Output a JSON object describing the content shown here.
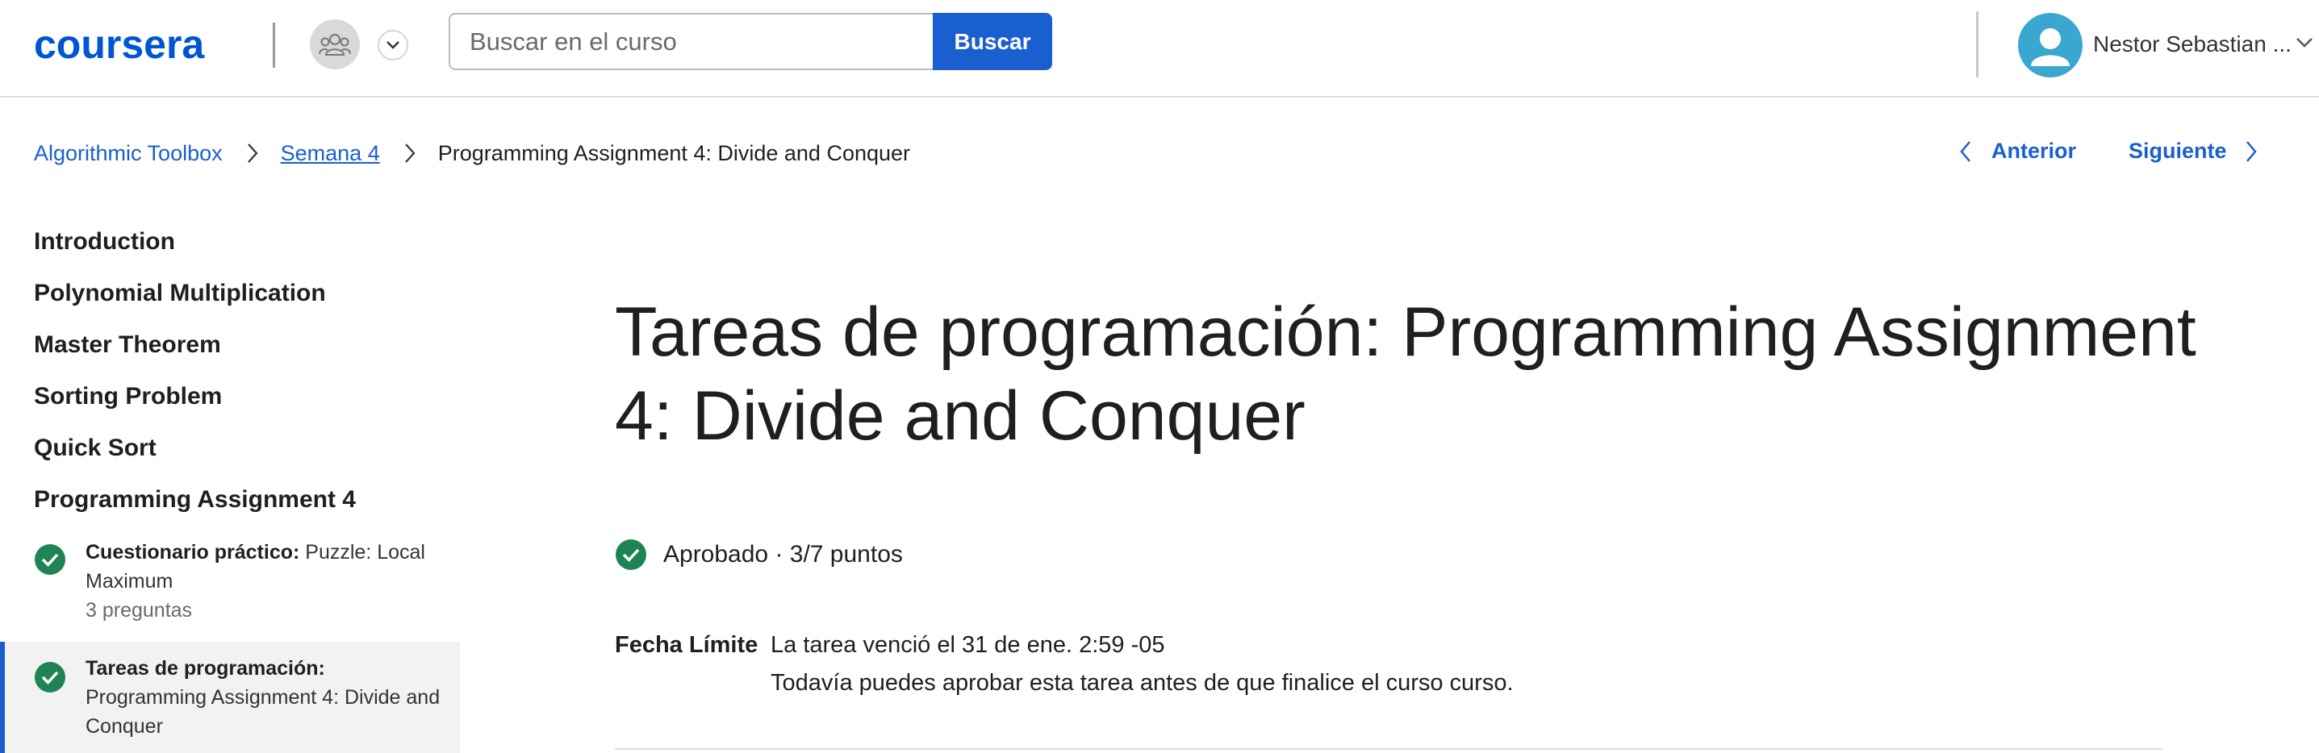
{
  "header": {
    "logo_text": "coursera",
    "search_placeholder": "Buscar en el curso",
    "search_button": "Buscar",
    "user_name": "Nestor Sebastian ..."
  },
  "breadcrumb": [
    {
      "label": "Algorithmic Toolbox"
    },
    {
      "label": "Semana 4"
    },
    {
      "label": "Programming Assignment 4: Divide and Conquer"
    }
  ],
  "nav": {
    "prev": "Anterior",
    "next": "Siguiente"
  },
  "sidebar": {
    "sections": [
      "Introduction",
      "Polynomial Multiplication",
      "Master Theorem",
      "Sorting Problem",
      "Quick Sort",
      "Programming Assignment 4"
    ],
    "items": [
      {
        "type": "Cuestionario práctico:",
        "title": "Puzzle: Local Maximum",
        "sub": "3 preguntas",
        "active": false
      },
      {
        "type": "Tareas de programación:",
        "title": "Programming Assignment 4: Divide and Conquer",
        "sub": "",
        "active": true
      }
    ]
  },
  "main": {
    "title": "Tareas de programación: Programming Assignment 4: Divide and Conquer",
    "grade": "Aprobado · 3/7 puntos",
    "deadline_label": "Fecha Límite",
    "deadline_text": "La tarea venció el 31 de ene. 2:59 -05",
    "deadline_note": "Todavía puedes aprobar esta tarea antes de que finalice el curso curso."
  },
  "colors": {
    "brand_blue": "#1a5fd0",
    "success_green": "#1f8354",
    "avatar_blue": "#3aa7d1"
  }
}
